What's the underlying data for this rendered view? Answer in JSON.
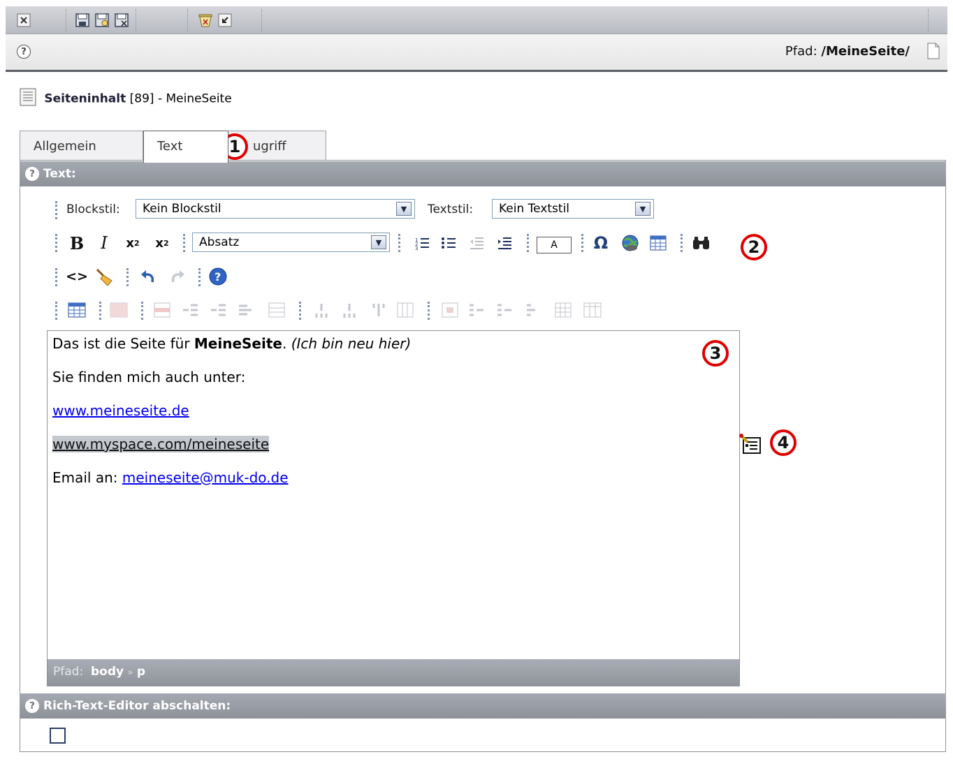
{
  "docbar": {
    "path_label": "Pfad:",
    "path_value": "/MeineSeite/"
  },
  "page_header": {
    "title_bold": "Seiteninhalt",
    "title_rest": "[89] - MeineSeite"
  },
  "tabs": [
    {
      "label": "Allgemein"
    },
    {
      "label": "Text"
    },
    {
      "label": "ugriff"
    }
  ],
  "section_text": {
    "label": "Text:"
  },
  "editor": {
    "blockstil_label": "Blockstil:",
    "blockstil_value": "Kein Blockstil",
    "textstil_label": "Textstil:",
    "textstil_value": "Kein Textstil",
    "format_value": "Absatz",
    "color_box_label": "A",
    "bold_glyph": "B",
    "italic_glyph": "I"
  },
  "content": {
    "line1_a": "Das ist die Seite für ",
    "line1_bold": "MeineSeite",
    "line1_b": ". ",
    "line1_italic": "(Ich bin neu hier)",
    "line2": "Sie finden mich auch unter:",
    "link1": "www.meineseite.de",
    "link2": "www.myspace.com/meineseite",
    "line5_label": "Email an: ",
    "link3": "meineseite@muk-do.de"
  },
  "statusbar": {
    "label": "Pfad:",
    "path_body": "body",
    "sep": "»",
    "path_p": "p"
  },
  "section_rte": {
    "label": "Rich-Text-Editor abschalten:"
  },
  "markers": [
    "1",
    "2",
    "3",
    "4"
  ],
  "icons": [
    "close-icon",
    "save-icon",
    "save-view-icon",
    "save-close-icon",
    "delete-icon",
    "undo-icon",
    "help-icon",
    "page-icon",
    "document-icon",
    "ordered-list-icon",
    "unordered-list-icon",
    "outdent-icon",
    "indent-icon",
    "special-char-icon",
    "link-icon",
    "table-icon",
    "find-icon",
    "source-icon",
    "clean-icon",
    "redo-icon",
    "about-icon",
    "rte-toggle-icon"
  ]
}
